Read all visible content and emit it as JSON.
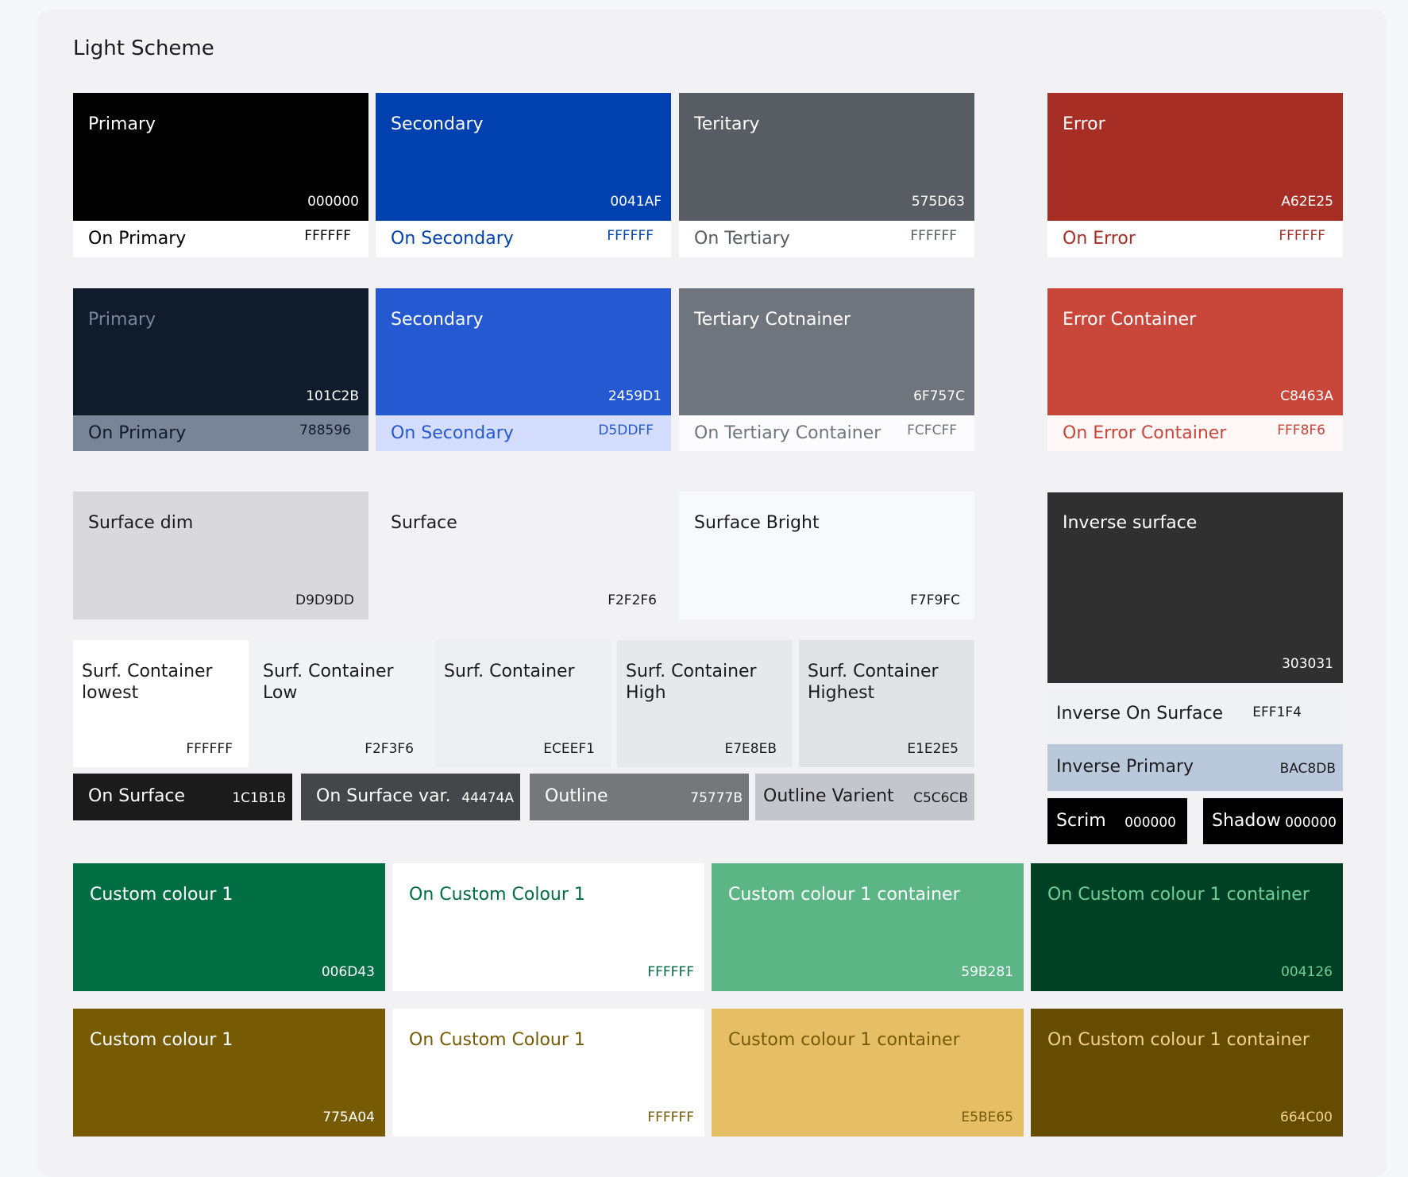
{
  "title": "Light Scheme",
  "row1": [
    {
      "label": "Primary",
      "hex": "000000",
      "on_label": "On Primary",
      "on_hex": "FFFFFF",
      "color": "#000000",
      "on_color": "#FFFFFF",
      "text": "#FFFFFF",
      "on_text": "#000000"
    },
    {
      "label": "Secondary",
      "hex": "0041AF",
      "on_label": "On Secondary",
      "on_hex": "FFFFFF",
      "color": "#0041AF",
      "on_color": "#FFFFFF",
      "text": "#FFFFFF",
      "on_text": "#0041AF"
    },
    {
      "label": "Teritary",
      "hex": "575D63",
      "on_label": "On Tertiary",
      "on_hex": "FFFFFF",
      "color": "#575D63",
      "on_color": "#FFFFFF",
      "text": "#FFFFFF",
      "on_text": "#575D63"
    },
    {
      "label": "Error",
      "hex": "A62E25",
      "on_label": "On Error",
      "on_hex": "FFFFFF",
      "color": "#A62E25",
      "on_color": "#FFFFFF",
      "text": "#FFFFFF",
      "on_text": "#A62E25"
    }
  ],
  "row2": [
    {
      "label": "Primary",
      "hex": "101C2B",
      "on_label": "On Primary",
      "on_hex": "788596",
      "color": "#101C2B",
      "on_color": "#788596",
      "text": "#788596",
      "hex_text": "#FFFFFF",
      "on_text": "#101C2B"
    },
    {
      "label": "Secondary",
      "hex": "2459D1",
      "on_label": "On Secondary",
      "on_hex": "D5DDFF",
      "color": "#2459D1",
      "on_color": "#D5DDFF",
      "text": "#FFFFFF",
      "hex_text": "#FFFFFF",
      "on_text": "#2459D1"
    },
    {
      "label": "Tertiary Cotnainer",
      "hex": "6F757C",
      "on_label": "On Tertiary Container",
      "on_hex": "FCFCFF",
      "color": "#6F757C",
      "on_color": "#FCFCFF",
      "text": "#FFFFFF",
      "hex_text": "#FFFFFF",
      "on_text": "#6F757C"
    },
    {
      "label": "Error Container",
      "hex": "C8463A",
      "on_label": "On Error Container",
      "on_hex": "FFF8F6",
      "color": "#C8463A",
      "on_color": "#FFF8F6",
      "text": "#FFFFFF",
      "hex_text": "#FFFFFF",
      "on_text": "#C8463A"
    }
  ],
  "surfaces": [
    {
      "label": "Surface dim",
      "hex": "D9D9DD",
      "color": "#D9D9DD"
    },
    {
      "label": "Surface",
      "hex": "F2F2F6",
      "color": "#F2F2F6"
    },
    {
      "label": "Surface Bright",
      "hex": "F7F9FC",
      "color": "#F7F9FC"
    }
  ],
  "inverse_surface": {
    "label": "Inverse surface",
    "hex": "303031",
    "color": "#303031"
  },
  "containers": [
    {
      "label": "Surf. Container\nlowest",
      "hex": "FFFFFF",
      "color": "#FFFFFF"
    },
    {
      "label": "Surf. Container\nLow",
      "hex": "F2F3F6",
      "color": "#F2F3F6"
    },
    {
      "label": "Surf. Container",
      "hex": "ECEEF1",
      "color": "#ECEEF1"
    },
    {
      "label": "Surf. Container\nHigh",
      "hex": "E7E8EB",
      "color": "#E7E8EB"
    },
    {
      "label": "Surf. Container\nHighest",
      "hex": "E1E2E5",
      "color": "#E1E2E5"
    }
  ],
  "on_bars": [
    {
      "label": "On Surface",
      "hex": "1C1B1B",
      "color": "#1C1B1B",
      "text": "#FFFFFF"
    },
    {
      "label": "On Surface var.",
      "hex": "44474A",
      "color": "#44474A",
      "text": "#FFFFFF"
    },
    {
      "label": "Outline",
      "hex": "75777B",
      "color": "#75777B",
      "text": "#FFFFFF"
    },
    {
      "label": "Outline Varient",
      "hex": "C5C6CB",
      "color": "#C5C6CB",
      "text": "#1C1B1F"
    }
  ],
  "inverse_on_surface": {
    "label": "Inverse On Surface",
    "hex": "EFF1F4",
    "color": "#EFF1F4"
  },
  "inverse_primary": {
    "label": "Inverse Primary",
    "hex": "BAC8DB",
    "color": "#BAC8DB"
  },
  "scrim": {
    "label": "Scrim",
    "hex": "000000"
  },
  "shadow": {
    "label": "Shadow",
    "hex": "000000"
  },
  "custom_green": [
    {
      "label": "Custom colour 1",
      "hex": "006D43",
      "color": "#006D43",
      "text": "#FFFFFF"
    },
    {
      "label": "On Custom Colour 1",
      "hex": "FFFFFF",
      "color": "#FFFFFF",
      "text": "#006D43"
    },
    {
      "label": "Custom colour 1 container",
      "hex": "59B281",
      "color": "#5BB584",
      "text": "#FFFFFF"
    },
    {
      "label": "On Custom colour 1 container",
      "hex": "004126",
      "color": "#004126",
      "text": "#6FCF98"
    }
  ],
  "custom_gold": [
    {
      "label": "Custom colour 1",
      "hex": "775A04",
      "color": "#775A04",
      "text": "#FFFFFF"
    },
    {
      "label": "On Custom Colour 1",
      "hex": "FFFFFF",
      "color": "#FFFFFF",
      "text": "#775A04"
    },
    {
      "label": "Custom colour 1 container",
      "hex": "E5BE65",
      "color": "#E5BE65",
      "text": "#775A04"
    },
    {
      "label": "On Custom colour 1 container",
      "hex": "664C00",
      "color": "#664C00",
      "text": "#F2D28C"
    }
  ]
}
